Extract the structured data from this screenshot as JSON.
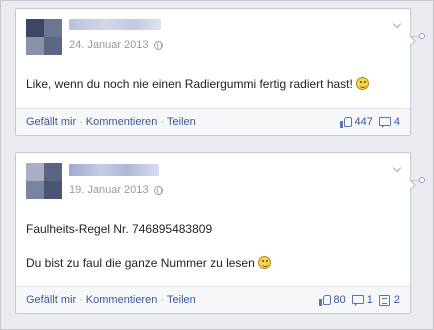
{
  "posts": [
    {
      "date": "24. Januar 2013",
      "text": "Like, wenn du noch nie einen Radiergummi fertig radiert hast!",
      "actions": [
        "Gefällt mir",
        "Kommentieren",
        "Teilen"
      ],
      "likes": "447",
      "comments": "4"
    },
    {
      "date": "19. Januar 2013",
      "text_line1": "Faulheits-Regel Nr. 746895483809",
      "text_line2": "Du bist zu faul die ganze Nummer zu lesen",
      "actions": [
        "Gefällt mir",
        "Kommentieren",
        "Teilen"
      ],
      "likes": "80",
      "comments": "1",
      "shares": "2"
    }
  ],
  "icons": {
    "avatar": "profile-avatar",
    "privacy": "globe-icon",
    "menu": "chevron-down-icon",
    "emoticon": "smiley-icon",
    "like": "thumbs-up-icon",
    "comment": "comment-bubble-icon",
    "share": "share-icon"
  },
  "colors": {
    "link": "#3b5998",
    "meta": "#999999",
    "background": "#e9ebf0"
  }
}
